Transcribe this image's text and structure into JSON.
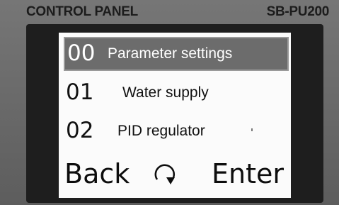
{
  "panel": {
    "title": "CONTROL PANEL",
    "model": "SB-PU200"
  },
  "menu": {
    "items": [
      {
        "number": "00",
        "label": "Parameter settings",
        "selected": true
      },
      {
        "number": "01",
        "label": "Water supply",
        "selected": false
      },
      {
        "number": "02",
        "label": "PID regulator",
        "selected": false
      }
    ]
  },
  "softkeys": {
    "back_label": "Back",
    "enter_label": "Enter",
    "rotate_icon": "rotate-clockwise-icon"
  },
  "colors": {
    "housing": "#6b6b6b",
    "bezel": "#1e1e1e",
    "screen": "#fbfbfb",
    "highlight": "#6c6c6c"
  }
}
